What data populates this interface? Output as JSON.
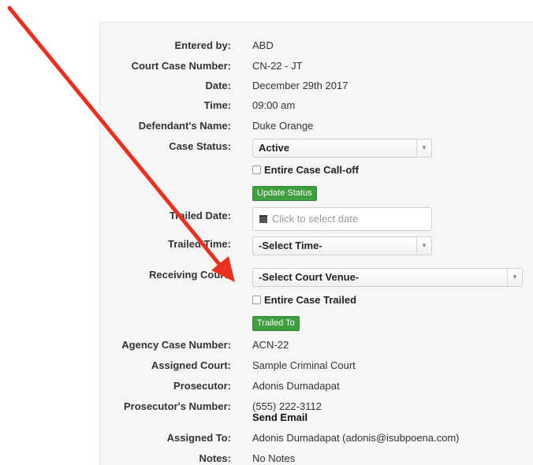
{
  "rows": {
    "entered_by": {
      "label": "Entered by:",
      "value": "ABD"
    },
    "court_case_number": {
      "label": "Court Case Number:",
      "value": "CN-22 - JT"
    },
    "date": {
      "label": "Date:",
      "value": "December 29th 2017"
    },
    "time": {
      "label": "Time:",
      "value": "09:00 am"
    },
    "defendant_name": {
      "label": "Defendant's Name:",
      "value": "Duke Orange"
    },
    "case_status": {
      "label": "Case Status:",
      "selected": "Active"
    },
    "trailed_date": {
      "label": "Trailed Date:",
      "placeholder": "Click to select date"
    },
    "trailed_time": {
      "label": "Trailed Time:",
      "selected": "-Select Time-"
    },
    "receiving_court": {
      "label": "Receiving Court:",
      "selected": "-Select Court Venue-"
    },
    "agency_case_number": {
      "label": "Agency Case Number:",
      "value": "ACN-22"
    },
    "assigned_court": {
      "label": "Assigned Court:",
      "value": "Sample Criminal Court"
    },
    "prosecutor": {
      "label": "Prosecutor:",
      "value": "Adonis Dumadapat"
    },
    "prosecutor_number": {
      "label": "Prosecutor's Number:",
      "value": "(555) 222-3112",
      "send_email": "Send Email"
    },
    "assigned_to": {
      "label": "Assigned To:",
      "value": "Adonis Dumadapat (adonis@isubpoena.com)"
    },
    "notes": {
      "label": "Notes:",
      "value": "No Notes"
    }
  },
  "controls": {
    "entire_case_calloff": "Entire Case Call-off",
    "update_status": "Update Status",
    "entire_case_trailed": "Entire Case Trailed",
    "trailed_to": "Trailed To"
  },
  "icons": {
    "dropdown": "chevron-down-icon",
    "calendar": "calendar-icon"
  },
  "colors": {
    "button_green": "#3f9e3f",
    "annotation_arrow": "#e8321f"
  }
}
